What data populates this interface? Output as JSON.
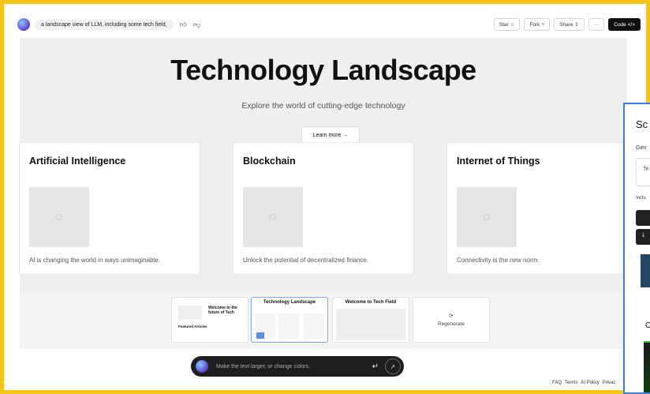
{
  "topbar": {
    "prompt": "a landscape view of LLM, including some tech field,",
    "star_label": "Star ☆",
    "fork_label": "Fork ⑂",
    "share_label": "Share ⇪",
    "more_label": "···",
    "code_label": "Code </>"
  },
  "hero": {
    "title": "Technology Landscape",
    "subtitle": "Explore the world of cutting-edge technology",
    "cta": "Learn more →"
  },
  "cards": [
    {
      "title": "Artificial Intelligence",
      "text": "AI is changing the world in ways unimaginable."
    },
    {
      "title": "Blockchain",
      "text": "Unlock the potential of decentralized finance."
    },
    {
      "title": "Internet of Things",
      "text": "Connectivity is the new norm."
    }
  ],
  "thumbnails": [
    {
      "title": "Welcome to the future of Tech",
      "section": "Featured Articles"
    },
    {
      "title": "Technology Landscape"
    },
    {
      "title": "Welcome to Tech Field"
    }
  ],
  "regenerate_label": "Regenerate",
  "chat": {
    "placeholder": "Make the text larger, or change colors."
  },
  "footer": {
    "links": [
      "FAQ",
      "Terms",
      "AI Policy",
      "Privac"
    ]
  },
  "side_panel": {
    "title": "Sc",
    "gen": "Gen",
    "input": "Te",
    "include": "Inclu"
  }
}
